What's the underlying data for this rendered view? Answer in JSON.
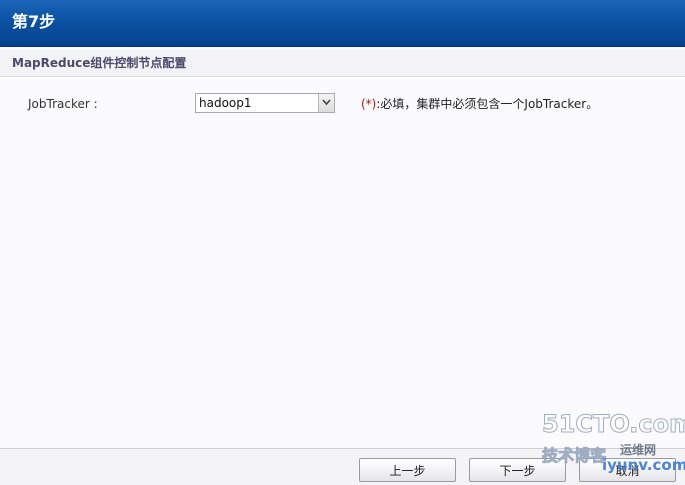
{
  "window": {
    "title": "第7步"
  },
  "section": {
    "title": "MapReduce组件控制节点配置"
  },
  "form": {
    "jobtracker": {
      "label": "JobTracker :",
      "selected": "hadoop1",
      "required_mark": "(*)",
      "hint": ":必填，集群中必须包含一个JobTracker。"
    }
  },
  "buttons": {
    "prev": "上一步",
    "next": "下一步",
    "cancel": "取消"
  },
  "watermark": {
    "main": "51CTO.com",
    "sub": "技术博客",
    "tag": "运维网",
    "site": "iyunv.com"
  },
  "colors": {
    "titlebar": "#0b52a3",
    "required": "#b01515"
  },
  "icons": {
    "dropdown": "chevron-down-icon"
  }
}
